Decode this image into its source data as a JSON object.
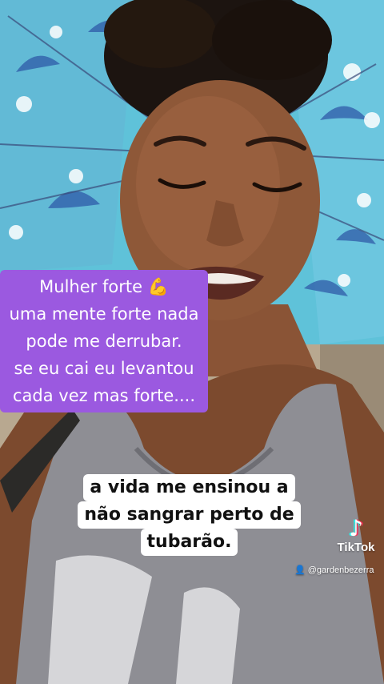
{
  "caption_top": {
    "lines": [
      "Mulher  forte 💪",
      "uma mente forte nada",
      "pode me derrubar.",
      "se eu cai eu levantou",
      "cada vez mas forte...."
    ]
  },
  "caption_bottom": {
    "lines": [
      "a vida me ensinou a",
      "não   sangrar  perto de",
      "tubarão."
    ]
  },
  "watermark": {
    "logo_icon": "tiktok-note-icon",
    "brand": "TikTok",
    "username": "@gardenbezerra",
    "user_icon": "person-icon"
  },
  "colors": {
    "purple_box": "#9b59e0",
    "caption_white": "#ffffff",
    "umbrella": "#5fc2d9",
    "shirt": "#8e8e94"
  }
}
